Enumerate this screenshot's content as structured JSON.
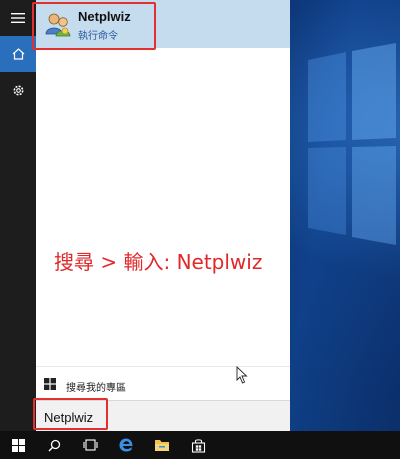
{
  "search_result": {
    "title": "Netplwiz",
    "subtitle": "執行命令",
    "icon": "users-icon"
  },
  "annotation": {
    "text": "搜尋 > 輸入: Netplwiz",
    "color": "#e0282a"
  },
  "my_stuff": {
    "label": "搜尋我的專區",
    "icon": "windows-logo-icon"
  },
  "search_box": {
    "value": "Netplwiz"
  },
  "rail": {
    "items": [
      "hamburger-menu-icon",
      "home-icon",
      "settings-icon"
    ]
  },
  "taskbar": {
    "items": [
      "start-button",
      "search-icon",
      "task-view-icon",
      "edge-icon",
      "file-explorer-icon",
      "store-icon"
    ]
  },
  "colors": {
    "accent": "#2a6fbb",
    "highlight": "#c5dcee",
    "annotation_box": "#e03030"
  }
}
